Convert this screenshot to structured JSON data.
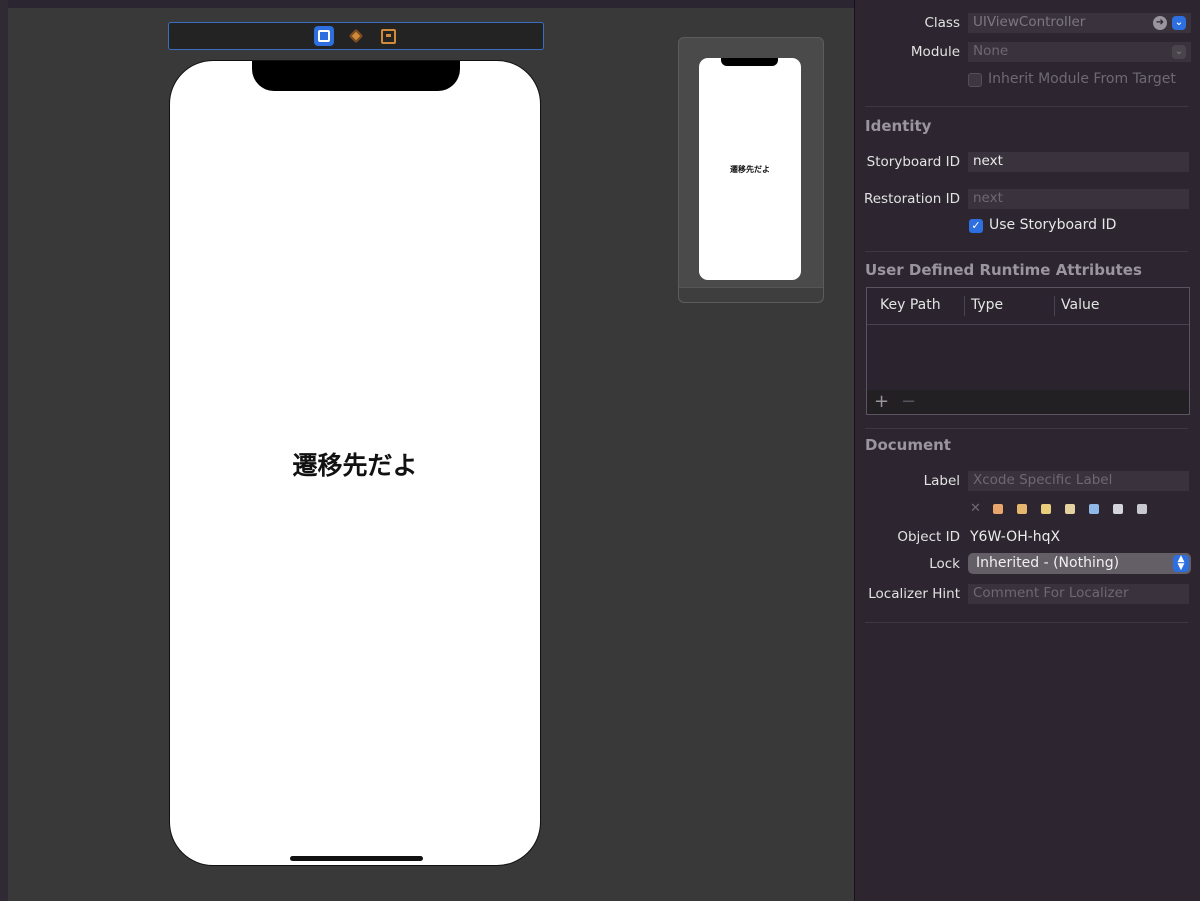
{
  "canvas": {
    "scene_icons": [
      "view-controller-icon",
      "first-responder-icon",
      "exit-icon"
    ],
    "phone_label": "遷移先だよ",
    "mini_phone_label": "遷移先だよ"
  },
  "inspector": {
    "custom_class": {
      "class_label": "Class",
      "class_value": "UIViewController",
      "module_label": "Module",
      "module_value": "None",
      "inherit_label": "Inherit Module From Target"
    },
    "identity": {
      "title": "Identity",
      "storyboard_id_label": "Storyboard ID",
      "storyboard_id_value": "next",
      "restoration_id_label": "Restoration ID",
      "restoration_id_placeholder": "next",
      "use_storyboard_id_label": "Use Storyboard ID"
    },
    "runtime_attributes": {
      "title": "User Defined Runtime Attributes",
      "columns": [
        "Key Path",
        "Type",
        "Value"
      ],
      "add": "+",
      "remove": "−"
    },
    "document": {
      "title": "Document",
      "label_label": "Label",
      "label_placeholder": "Xcode Specific Label",
      "clear": "✕",
      "swatch_colors": [
        "#e9a56b",
        "#e6b56e",
        "#e8cd7c",
        "#e4d3a0",
        "#8fb8e8",
        "#d4d4dc",
        "#c8c8d0"
      ],
      "object_id_label": "Object ID",
      "object_id_value": "Y6W-OH-hqX",
      "lock_label": "Lock",
      "lock_value": "Inherited - (Nothing)",
      "localizer_label": "Localizer Hint",
      "localizer_placeholder": "Comment For Localizer"
    }
  }
}
